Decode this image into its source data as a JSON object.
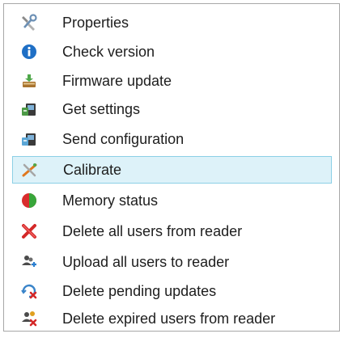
{
  "menu": {
    "items": [
      {
        "label": "Properties",
        "icon": "tools-icon"
      },
      {
        "label": "Check version",
        "icon": "info-icon"
      },
      {
        "label": "Firmware update",
        "icon": "firmware-icon"
      },
      {
        "label": "Get settings",
        "icon": "get-settings-icon"
      },
      {
        "label": "Send configuration",
        "icon": "send-configuration-icon"
      },
      {
        "label": "Calibrate",
        "icon": "calibrate-icon",
        "selected": true
      },
      {
        "label": "Memory status",
        "icon": "memory-pie-icon"
      },
      {
        "label": "Delete all users from reader",
        "icon": "delete-x-icon"
      },
      {
        "label": "Upload all users to reader",
        "icon": "users-upload-icon"
      },
      {
        "label": "Delete pending updates",
        "icon": "delete-pending-icon"
      },
      {
        "label": "Delete expired users from reader",
        "icon": "delete-expired-users-icon"
      }
    ]
  },
  "colors": {
    "selected_background": "#ddf2f9",
    "selected_border": "#8cd0e6",
    "text": "#1d1d1d",
    "menu_border": "#a7a7a7"
  }
}
